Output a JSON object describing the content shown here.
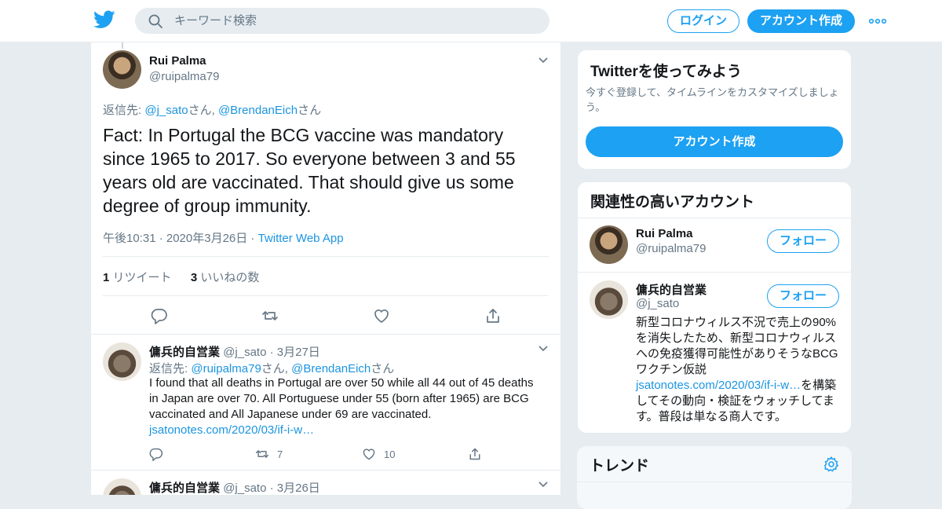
{
  "header": {
    "search_placeholder": "キーワード検索",
    "login_label": "ログイン",
    "signup_label": "アカウント作成",
    "brand_color": "#1da1f2"
  },
  "main_tweet": {
    "name": "Rui Palma",
    "handle": "@ruipalma79",
    "reply_prefix": "返信先: ",
    "reply_to_1": "@j_sato",
    "reply_mid": "さん, ",
    "reply_to_2": "@BrendanEich",
    "reply_suffix": "さん",
    "text": "Fact: In Portugal the BCG vaccine was mandatory since 1965 to 2017. So everyone between 3 and 55 years old are vaccinated. That should give us some degree of group immunity.",
    "time": "午後10:31 · 2020年3月26日 · ",
    "source": "Twitter Web App",
    "retweets": "1",
    "retweets_label": " リツイート",
    "likes": "3",
    "likes_label": " いいねの数"
  },
  "replies": [
    {
      "name": "傭兵的自営業",
      "handle": "@j_sato",
      "date": " · 3月27日",
      "reply_prefix": "返信先: ",
      "reply_to_1": "@ruipalma79",
      "reply_mid": "さん, ",
      "reply_to_2": "@BrendanEich",
      "reply_suffix": "さん",
      "text": "I found that all deaths in Portugal are over 50 while all 44 out of 45 deaths in Japan are over 70. All Portuguese under 55 (born after 1965) are BCG vaccinated and All Japanese under 69 are vaccinated.",
      "link": "jsatonotes.com/2020/03/if-i-w…",
      "retweets": "7",
      "likes": "10"
    },
    {
      "name": "傭兵的自営業",
      "handle": "@j_sato",
      "date": " · 3月26日"
    }
  ],
  "sidebar": {
    "signup_card": {
      "title": "Twitterを使ってみよう",
      "subtitle": "今すぐ登録して、タイムラインをカスタマイズしましょう。",
      "button": "アカウント作成"
    },
    "related": {
      "title": "関連性の高いアカウント",
      "follow_label": "フォロー",
      "accounts": [
        {
          "name": "Rui Palma",
          "handle": "@ruipalma79"
        },
        {
          "name": "傭兵的自営業",
          "handle": "@j_sato",
          "bio_text": "新型コロナウィルス不況で売上の90%を消失したため、新型コロナウィルスへの免疫獲得可能性がありそうなBCGワクチン仮説",
          "bio_link": "jsatonotes.com/2020/03/if-i-w…",
          "bio_tail": "を構築してその動向・検証をウォッチしてます。普段は単なる商人です。"
        }
      ]
    },
    "trends": {
      "title": "トレンド"
    }
  }
}
